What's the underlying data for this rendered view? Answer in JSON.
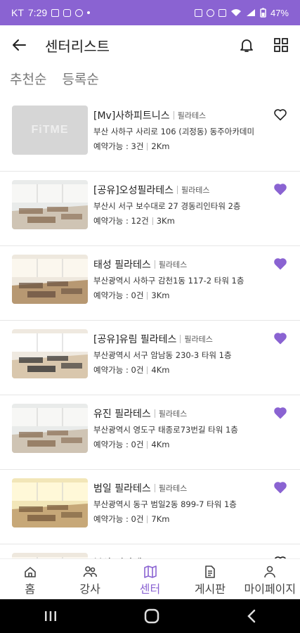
{
  "status_bar": {
    "carrier": "KT",
    "time": "7:29",
    "battery": "47%"
  },
  "header": {
    "title": "센터리스트"
  },
  "sort_tabs": [
    "추천순",
    "등록순"
  ],
  "centers": [
    {
      "name": "[Mv]사하피트니스",
      "category": "필라테스",
      "address": "부산 사하구 사리로 106 (괴정동) 동주아카데미",
      "reservation": "예약가능 : 3건",
      "distance": "2Km",
      "favorite": false,
      "thumb": "placeholder",
      "placeholder_text": "FiTME"
    },
    {
      "name": "[공유]오성필라테스",
      "category": "필라테스",
      "address": "부산시 서구 보수대로 27 경동리인타워 2층",
      "reservation": "예약가능 : 12건",
      "distance": "3Km",
      "favorite": true,
      "thumb": "studio-a"
    },
    {
      "name": "태성 필라테스",
      "category": "필라테스",
      "address": "부산광역시 사하구 감천1동 117-2 타워 1층",
      "reservation": "예약가능 : 0건",
      "distance": "3Km",
      "favorite": true,
      "thumb": "studio-b"
    },
    {
      "name": "[공유]유림 필라테스",
      "category": "필라테스",
      "address": "부산광역시 서구 암남동 230-3 타워 1층",
      "reservation": "예약가능 : 0건",
      "distance": "4Km",
      "favorite": true,
      "thumb": "studio-c"
    },
    {
      "name": "유진 필라테스",
      "category": "필라테스",
      "address": "부산광역시 영도구 태종로73번길 타워 1층",
      "reservation": "예약가능 : 0건",
      "distance": "4Km",
      "favorite": true,
      "thumb": "studio-a"
    },
    {
      "name": "범일 필라테스",
      "category": "필라테스",
      "address": "부산광역시 동구 범일2동 899-7 타워 1층",
      "reservation": "예약가능 : 0건",
      "distance": "7Km",
      "favorite": true,
      "thumb": "studio-d"
    },
    {
      "name": "부산 필라테스",
      "category": "필라테스",
      "address": "",
      "reservation": "",
      "distance": "",
      "favorite": false,
      "thumb": "studio-b"
    }
  ],
  "tabs": [
    {
      "label": "홈",
      "icon": "home-icon",
      "active": false
    },
    {
      "label": "강사",
      "icon": "people-icon",
      "active": false
    },
    {
      "label": "센터",
      "icon": "map-icon",
      "active": true
    },
    {
      "label": "게시판",
      "icon": "document-icon",
      "active": false
    },
    {
      "label": "마이페이지",
      "icon": "person-icon",
      "active": false
    }
  ],
  "colors": {
    "accent": "#8a63d2",
    "status_bar": "#8a63d2"
  }
}
